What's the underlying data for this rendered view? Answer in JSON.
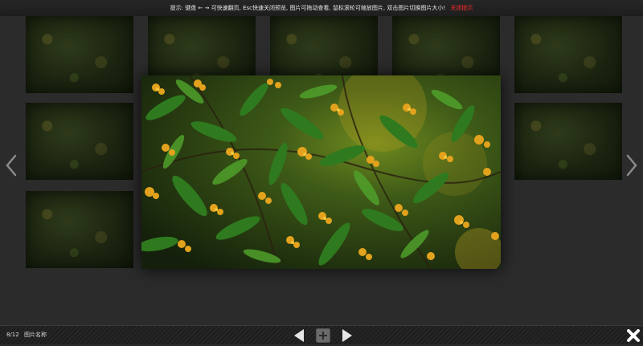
{
  "hint_bar": {
    "text": "提示: 键盘 ← → 可快速翻页, Esc快速关闭预览, 图片可拖动查看, 鼠标滚轮可缩放图片, 双击图片切换图片大小!",
    "close_label": "关闭提示"
  },
  "viewer": {
    "counter": "8/12",
    "caption": "图片名称"
  },
  "icons": {
    "prev": "chevron-left-icon",
    "next": "chevron-right-icon",
    "toolbar_prev": "triangle-left-icon",
    "toolbar_next": "triangle-right-icon",
    "zoom": "plus-icon",
    "close": "close-icon"
  },
  "colors": {
    "background": "#2b2b2b",
    "hint_close": "#ff2a2a",
    "foliage": "#2f6d1f",
    "blossom": "#e2a21d"
  }
}
